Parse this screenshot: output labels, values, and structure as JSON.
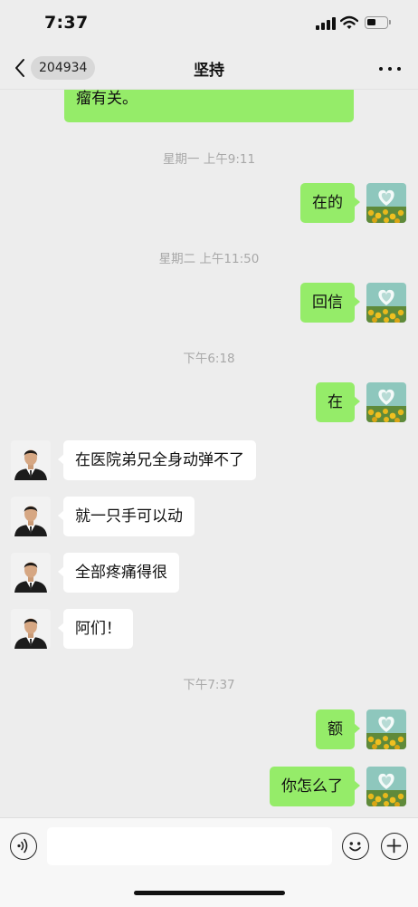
{
  "status_bar": {
    "time": "7:37"
  },
  "nav": {
    "unread_count": "204934",
    "title": "坚持"
  },
  "chat": {
    "partial_message": {
      "visible_text": "瘤有关。"
    },
    "timestamps": [
      "星期一 上午9:11",
      "星期二 上午11:50",
      "下午6:18",
      "下午7:37"
    ],
    "messages": [
      {
        "side": "right",
        "text": "在的"
      },
      {
        "side": "right",
        "text": "回信"
      },
      {
        "side": "right",
        "text": "在"
      },
      {
        "side": "left",
        "text": "在医院弟兄全身动弹不了"
      },
      {
        "side": "left",
        "text": "就一只手可以动"
      },
      {
        "side": "left",
        "text": "全部疼痛得很"
      },
      {
        "side": "left",
        "text": "阿们！"
      },
      {
        "side": "right",
        "text": "额"
      },
      {
        "side": "right",
        "text": "你怎么了"
      }
    ]
  },
  "input": {
    "value": "",
    "placeholder": ""
  },
  "icons": {
    "back": "chevron-left-icon",
    "more": "more-dots-icon",
    "voice": "voice-icon",
    "emoji": "emoji-icon",
    "plus": "plus-icon",
    "self_avatar": "heart-sunflower-avatar",
    "contact_avatar": "man-portrait-avatar"
  },
  "colors": {
    "sent_bubble": "#95ec69",
    "received_bubble": "#ffffff",
    "background": "#ededed"
  }
}
